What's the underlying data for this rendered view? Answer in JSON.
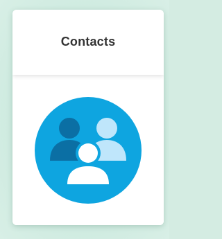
{
  "card": {
    "title": "Contacts",
    "icon": "contacts-people-icon"
  },
  "colors": {
    "background": "#d4ece2",
    "card": "#ffffff",
    "title_text": "#333333",
    "icon_circle": "#0ea5e0",
    "person_dark": "#0b6fa4",
    "person_light": "#bfe6fb",
    "person_front": "#ffffff"
  }
}
